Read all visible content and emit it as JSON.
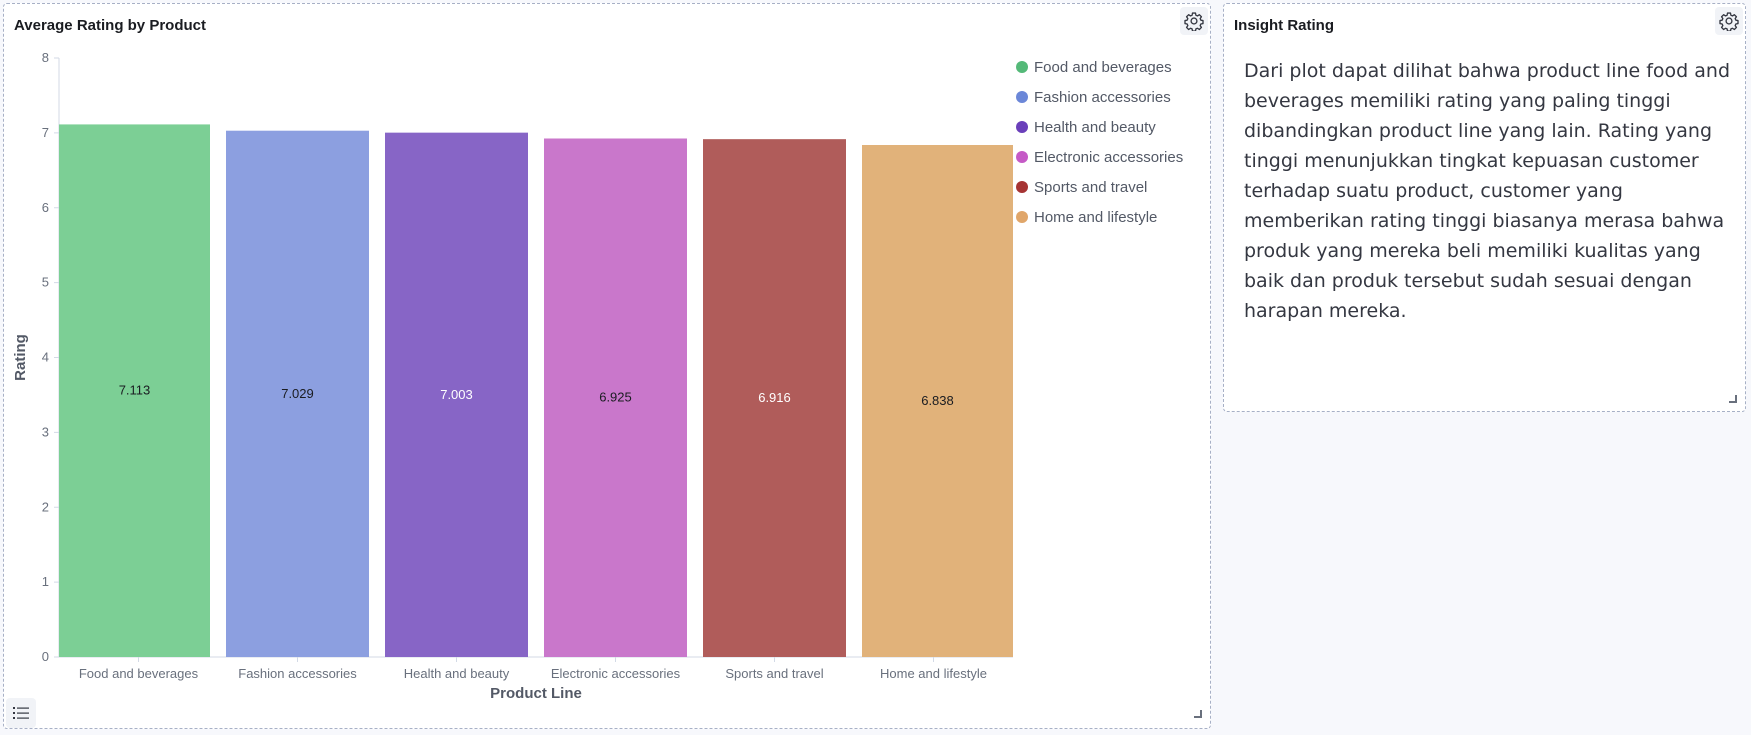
{
  "chart_panel": {
    "title": "Average Rating by Product",
    "settings_icon": "gear-icon",
    "legend_toggle_icon": "list-icon"
  },
  "insight_panel": {
    "title": "Insight Rating",
    "settings_icon": "gear-icon",
    "text": "Dari plot dapat dilihat bahwa product line food and beverages memiliki rating yang paling tinggi dibandingkan product line yang lain. Rating yang tinggi menunjukkan tingkat kepuasan customer terhadap suatu product, customer yang memberikan rating tinggi biasanya merasa bahwa produk yang mereka beli memiliki kualitas yang baik dan produk tersebut sudah sesuai dengan harapan mereka."
  },
  "chart_data": {
    "type": "bar",
    "title": "Average Rating by Product",
    "xlabel": "Product Line",
    "ylabel": "Rating",
    "ylim": [
      0,
      8
    ],
    "yticks": [
      0,
      1,
      2,
      3,
      4,
      5,
      6,
      7,
      8
    ],
    "categories": [
      "Food and beverages",
      "Fashion accessories",
      "Health and beauty",
      "Electronic accessories",
      "Sports and travel",
      "Home and lifestyle"
    ],
    "values": [
      7.113,
      7.029,
      7.003,
      6.925,
      6.916,
      6.838
    ],
    "value_labels": [
      "7.113",
      "7.029",
      "7.003",
      "6.925",
      "6.916",
      "6.838"
    ],
    "colors": [
      "#7ccf95",
      "#8c9fe0",
      "#8765c6",
      "#c977cb",
      "#b05c5a",
      "#e1b27a"
    ],
    "label_colors": [
      "#1a1c21",
      "#1a1c21",
      "#ffffff",
      "#1a1c21",
      "#ffffff",
      "#1a1c21"
    ],
    "legend_position": "top-right",
    "legend_dot_colors": [
      "#54b978",
      "#6b87d8",
      "#6a3fba",
      "#c55ac6",
      "#a63434",
      "#e0a66a"
    ],
    "grid": false
  }
}
